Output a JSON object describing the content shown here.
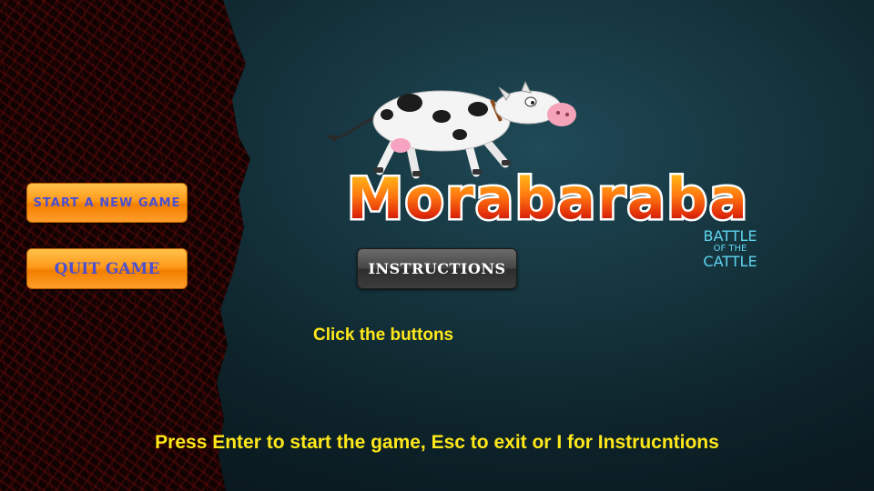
{
  "menu": {
    "start_label": "START A NEW GAME",
    "quit_label": "QUIT GAME",
    "instructions_label": "INSTRUCTIONS"
  },
  "logo": {
    "title": "Morabaraba",
    "subtitle_line1": "BATTLE",
    "subtitle_line2": "OF THE",
    "subtitle_line3": "CATTLE"
  },
  "hint_text": "Click the buttons",
  "footer_text": "Press Enter to start the game, Esc to exit or I for Instrucntions",
  "icons": {
    "mascot": "cow-icon"
  },
  "colors": {
    "button_orange": "#ff9a1c",
    "button_text": "#4b4fd0",
    "hint_yellow": "#ffe81a",
    "subtitle_cyan": "#5fd4f0"
  }
}
